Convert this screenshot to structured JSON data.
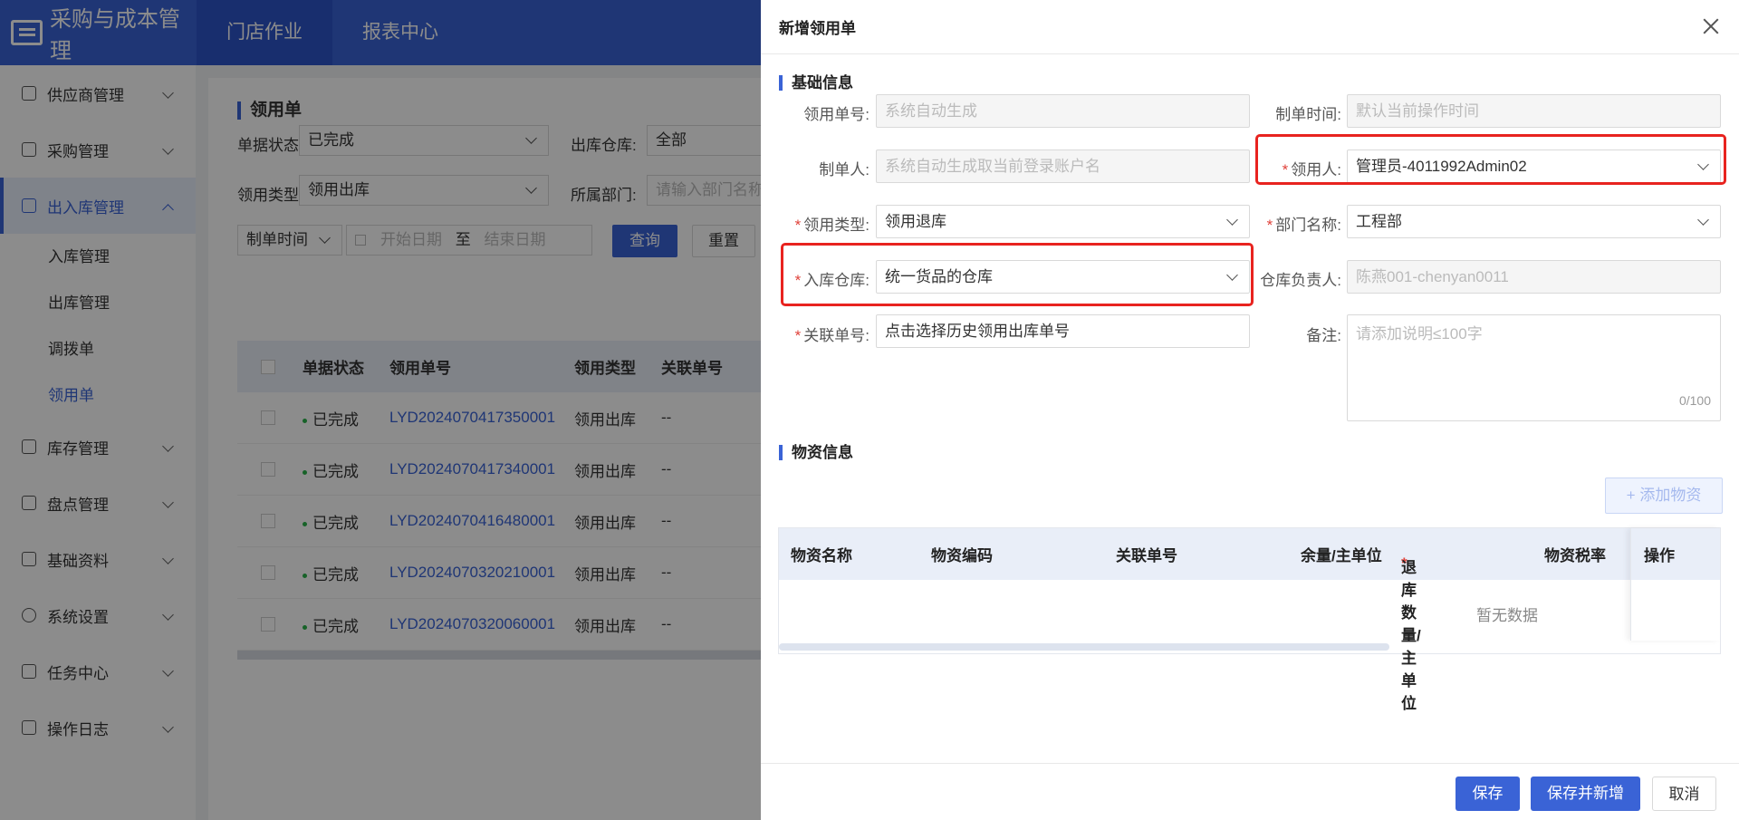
{
  "app": {
    "title": "采购与成本管理",
    "top_nav": [
      "门店作业",
      "报表中心"
    ]
  },
  "sidebar": {
    "items": [
      {
        "label": "供应商管理",
        "icon": "supplier-icon"
      },
      {
        "label": "采购管理",
        "icon": "purchase-icon"
      },
      {
        "label": "出入库管理",
        "icon": "inout-icon",
        "expanded": true
      },
      {
        "label": "库存管理",
        "icon": "stock-icon"
      },
      {
        "label": "盘点管理",
        "icon": "inventory-check-icon"
      },
      {
        "label": "基础资料",
        "icon": "basic-data-icon"
      },
      {
        "label": "系统设置",
        "icon": "gear-icon"
      },
      {
        "label": "任务中心",
        "icon": "task-icon"
      },
      {
        "label": "操作日志",
        "icon": "log-icon"
      }
    ],
    "sub_items": [
      "入库管理",
      "出库管理",
      "调拨单",
      "领用单"
    ]
  },
  "page": {
    "title": "领用单",
    "filters": {
      "status_label": "单据状态:",
      "status_value": "已完成",
      "warehouse_label": "出库仓库:",
      "warehouse_value": "全部",
      "type_label": "领用类型:",
      "type_value": "领用出库",
      "dept_label": "所属部门:",
      "dept_placeholder": "请输入部门名称",
      "time_type": "制单时间",
      "start_placeholder": "开始日期",
      "to": "至",
      "end_placeholder": "结束日期",
      "query": "查询",
      "reset": "重置"
    },
    "table": {
      "headers": [
        "单据状态",
        "领用单号",
        "领用类型",
        "关联单号"
      ],
      "rows": [
        {
          "status": "已完成",
          "no": "LYD2024070417350001",
          "type": "领用出库",
          "rel": "--"
        },
        {
          "status": "已完成",
          "no": "LYD2024070417340001",
          "type": "领用出库",
          "rel": "--"
        },
        {
          "status": "已完成",
          "no": "LYD2024070416480001",
          "type": "领用出库",
          "rel": "--"
        },
        {
          "status": "已完成",
          "no": "LYD2024070320210001",
          "type": "领用出库",
          "rel": "--"
        },
        {
          "status": "已完成",
          "no": "LYD2024070320060001",
          "type": "领用出库",
          "rel": "--"
        }
      ]
    }
  },
  "drawer": {
    "title": "新增领用单",
    "basic_section": "基础信息",
    "fields": {
      "order_no_label": "领用单号:",
      "order_no_placeholder": "系统自动生成",
      "create_time_label": "制单时间:",
      "create_time_placeholder": "默认当前操作时间",
      "creator_label": "制单人:",
      "creator_placeholder": "系统自动生成取当前登录账户名",
      "receiver_label": "领用人:",
      "receiver_value": "管理员-4011992Admin02",
      "type_label": "领用类型:",
      "type_value": "领用退库",
      "dept_label": "部门名称:",
      "dept_value": "工程部",
      "warehouse_label": "入库仓库:",
      "warehouse_value": "统一货品的仓库",
      "wh_manager_label": "仓库负责人:",
      "wh_manager_value": "陈燕001-chenyan0011",
      "rel_label": "关联单号:",
      "rel_value": "点击选择历史领用出库单号",
      "remark_label": "备注:",
      "remark_placeholder": "请添加说明≤100字",
      "remark_count": "0/100"
    },
    "material_section": "物资信息",
    "add_material": "+ 添加物资",
    "material_headers": [
      "物资名称",
      "物资编码",
      "关联单号",
      "余量/主单位",
      "退库数量/主单位",
      "物资税率",
      "操作"
    ],
    "empty_text": "暂无数据",
    "buttons": {
      "save": "保存",
      "save_new": "保存并新增",
      "cancel": "取消"
    }
  },
  "colors": {
    "primary": "#3a63d6",
    "highlight_box": "#e8231f",
    "required": "#e0423a",
    "success": "#2ab34a"
  }
}
